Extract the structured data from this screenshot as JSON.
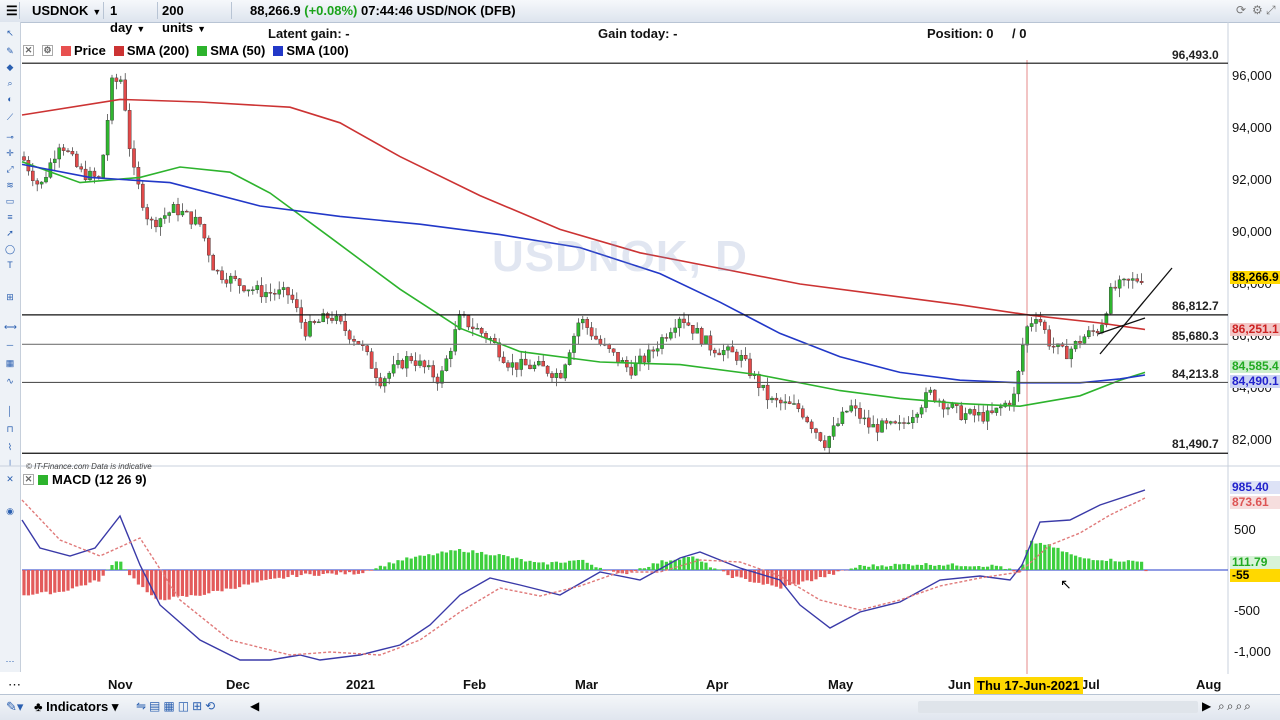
{
  "toolbar": {
    "symbol": "USDNOK",
    "interval": "1 day",
    "units": "200 units",
    "last_price": "88,266.9",
    "change": "(+0.08%)",
    "time": "07:44:46",
    "instrument": "USD/NOK (DFB)"
  },
  "info": {
    "latent_gain": "Latent gain: -",
    "gain_today": "Gain today: -",
    "position": "Position: 0",
    "position_slash": "/ 0"
  },
  "legend": {
    "price": "Price",
    "sma200": "SMA (200)",
    "sma50": "SMA (50)",
    "sma100": "SMA (100)",
    "colors": {
      "price": "#e8504f",
      "sma200": "#cc3333",
      "sma50": "#2db32d",
      "sma100": "#2238c8"
    }
  },
  "watermark": "USDNOK, D",
  "disclaimer": "© IT-Finance.com  Data is indicative",
  "price_axis": [
    "96,000",
    "94,000",
    "92,000",
    "90,000",
    "88,000",
    "86,000",
    "84,000",
    "82,000"
  ],
  "hlines": [
    "96,493.0",
    "86,812.7",
    "85,680.3",
    "84,213.8",
    "81,490.7"
  ],
  "tags": {
    "last": "88,266.9",
    "sma200": "86,251.1",
    "sma50": "84,585.4",
    "sma100": "84,490.1"
  },
  "macd": {
    "label": "MACD (12 26 9)",
    "axis": [
      "500",
      "-500",
      "-1,000"
    ],
    "tag_macd": "985.40",
    "tag_signal": "873.61",
    "tag_hist": "111.79",
    "tag_zero": "-55"
  },
  "xaxis": [
    "Nov",
    "Dec",
    "2021",
    "Feb",
    "Mar",
    "Apr",
    "May",
    "Jun",
    "Jul",
    "Aug"
  ],
  "crosshair_date": "Thu 17-Jun-2021",
  "bottom": {
    "indicators": "Indicators"
  }
}
